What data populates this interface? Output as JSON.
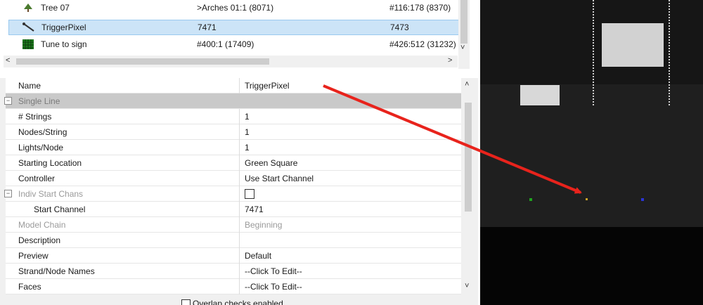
{
  "model_list": {
    "rows": [
      {
        "name": "Tree 07",
        "start": ">Arches 01:1 (8071)",
        "end": "#116:178 (8370)",
        "icon": "tree-icon"
      },
      {
        "name": "TriggerPixel",
        "start": "7471",
        "end": "7473",
        "icon": "single-line-icon",
        "selected": true
      },
      {
        "name": "Tune to sign",
        "start": "#400:1 (17409)",
        "end": "#426:512 (31232)",
        "icon": "matrix-icon"
      }
    ],
    "scroll_left": "<",
    "scroll_right": ">",
    "scroll_down": "˅"
  },
  "properties": {
    "rows": [
      {
        "name": "Name",
        "value": "TriggerPixel"
      },
      {
        "name": "Single Line",
        "value": "",
        "category": true
      },
      {
        "name": "# Strings",
        "value": "1"
      },
      {
        "name": "Nodes/String",
        "value": "1"
      },
      {
        "name": "Lights/Node",
        "value": "1"
      },
      {
        "name": "Starting Location",
        "value": "Green Square"
      },
      {
        "name": "Controller",
        "value": "Use Start Channel"
      },
      {
        "name": "Indiv Start Chans",
        "value": "",
        "checkbox": true,
        "disabled": true
      },
      {
        "name": "Start Channel",
        "value": "7471",
        "indent": true
      },
      {
        "name": "Model Chain",
        "value": "Beginning",
        "disabled": true
      },
      {
        "name": "Description",
        "value": ""
      },
      {
        "name": "Preview",
        "value": "Default"
      },
      {
        "name": "Strand/Node Names",
        "value": "--Click To Edit--"
      },
      {
        "name": "Faces",
        "value": "--Click To Edit--"
      }
    ],
    "scroll_up": "˄",
    "scroll_down": "˅",
    "footer_checkbox_label": "Overlap checks enabled"
  },
  "colors": {
    "selection": "#cce4f7",
    "arrow": "#e8231c",
    "node_green": "#1fa31f",
    "node_yellow": "#c9a227",
    "node_blue": "#2a35d6"
  }
}
